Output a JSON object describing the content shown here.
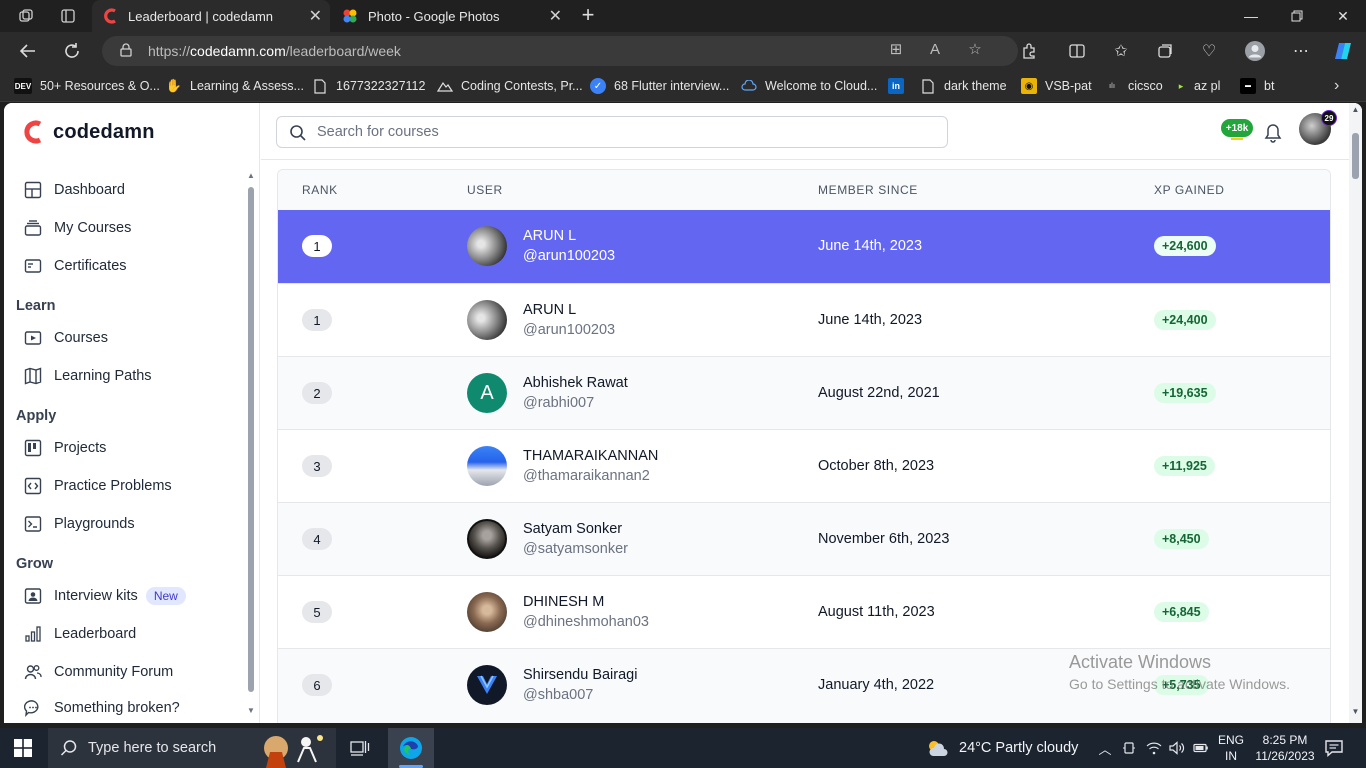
{
  "browser": {
    "tabs": [
      {
        "title": "Leaderboard | codedamn",
        "active": true
      },
      {
        "title": "Photo - Google Photos",
        "active": false
      }
    ],
    "url_prefix": "https://",
    "url_host": "codedamn.com",
    "url_path": "/leaderboard/week",
    "favorites": [
      {
        "label": "50+ Resources & O...",
        "icon": "dev-icon",
        "icon_text": "DEV"
      },
      {
        "label": "Learning & Assess...",
        "icon": "hand-icon"
      },
      {
        "label": "1677322327112",
        "icon": "page-icon"
      },
      {
        "label": "Coding Contests, Pr...",
        "icon": "mountain-icon"
      },
      {
        "label": "68 Flutter interview...",
        "icon": "check-badge-icon"
      },
      {
        "label": "Welcome to Cloud...",
        "icon": "cloud-icon"
      },
      {
        "label": "dark theme",
        "icon": "page-icon"
      },
      {
        "label": "VSB-pat",
        "icon": "vsb-icon"
      },
      {
        "label": "cicsco",
        "icon": "cisco-icon"
      },
      {
        "label": "az pl",
        "icon": "arrow-icon"
      },
      {
        "label": "bt",
        "icon": "bt-icon"
      }
    ]
  },
  "brand": {
    "name": "codedamn",
    "accent": "#ef4444"
  },
  "sidebar": {
    "top_items": [
      {
        "label": "Dashboard",
        "icon": "dashboard-icon"
      },
      {
        "label": "My Courses",
        "icon": "stack-icon"
      },
      {
        "label": "Certificates",
        "icon": "certificate-icon"
      }
    ],
    "groups": [
      {
        "title": "Learn",
        "items": [
          {
            "label": "Courses",
            "icon": "play-icon"
          },
          {
            "label": "Learning Paths",
            "icon": "map-icon"
          }
        ]
      },
      {
        "title": "Apply",
        "items": [
          {
            "label": "Projects",
            "icon": "kanban-icon"
          },
          {
            "label": "Practice Problems",
            "icon": "code-icon"
          },
          {
            "label": "Playgrounds",
            "icon": "terminal-icon"
          }
        ]
      },
      {
        "title": "Grow",
        "items": [
          {
            "label": "Interview kits",
            "icon": "id-card-icon",
            "badge": "New"
          },
          {
            "label": "Leaderboard",
            "icon": "bar-chart-icon"
          },
          {
            "label": "Community Forum",
            "icon": "users-icon"
          },
          {
            "label": "Something broken?",
            "icon": "chat-icon"
          }
        ]
      }
    ]
  },
  "topbar": {
    "search_placeholder": "Search for courses",
    "xp_badge": "+18k",
    "avatar_count": "29"
  },
  "leaderboard": {
    "columns": [
      "RANK",
      "USER",
      "MEMBER SINCE",
      "XP GAINED"
    ],
    "rows": [
      {
        "rank": "1",
        "name": "ARUN L",
        "handle": "@arun100203",
        "since": "June 14th, 2023",
        "xp": "+24,600",
        "highlight": true
      },
      {
        "rank": "1",
        "name": "ARUN L",
        "handle": "@arun100203",
        "since": "June 14th, 2023",
        "xp": "+24,400"
      },
      {
        "rank": "2",
        "name": "Abhishek Rawat",
        "handle": "@rabhi007",
        "since": "August 22nd, 2021",
        "xp": "+19,635",
        "avatar_letter": "A"
      },
      {
        "rank": "3",
        "name": "THAMARAIKANNAN",
        "handle": "@thamaraikannan2",
        "since": "October 8th, 2023",
        "xp": "+11,925"
      },
      {
        "rank": "4",
        "name": "Satyam Sonker",
        "handle": "@satyamsonker",
        "since": "November 6th, 2023",
        "xp": "+8,450"
      },
      {
        "rank": "5",
        "name": "DHINESH M",
        "handle": "@dhineshmohan03",
        "since": "August 11th, 2023",
        "xp": "+6,845"
      },
      {
        "rank": "6",
        "name": "Shirsendu Bairagi",
        "handle": "@shba007",
        "since": "January 4th, 2022",
        "xp": "+5,735"
      }
    ]
  },
  "watermark": {
    "line1": "Activate Windows",
    "line2": "Go to Settings to activate Windows."
  },
  "taskbar": {
    "search_placeholder": "Type here to search",
    "weather": "24°C  Partly cloudy",
    "lang_top": "ENG",
    "lang_bottom": "IN",
    "time": "8:25 PM",
    "date": "11/26/2023"
  }
}
